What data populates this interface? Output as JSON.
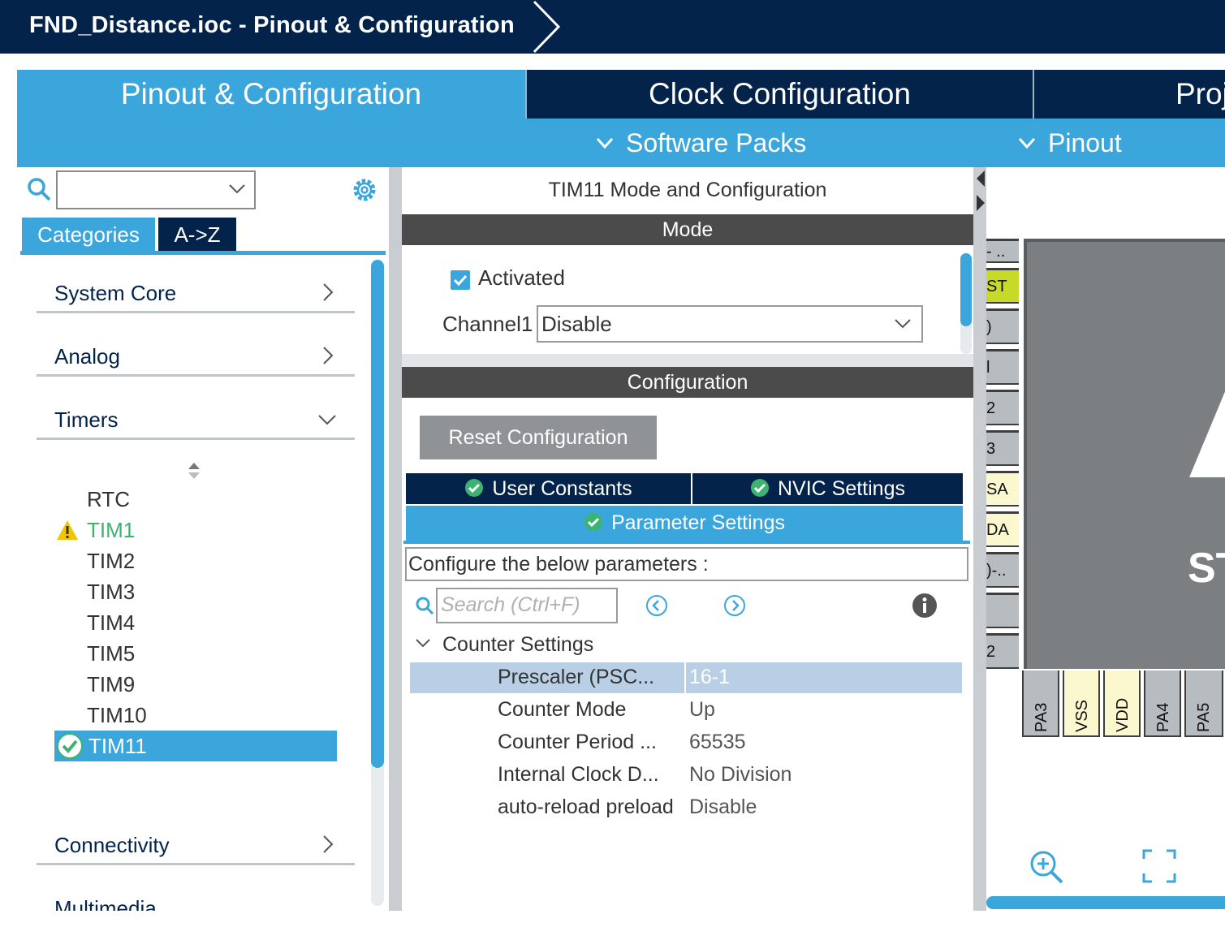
{
  "window": {
    "title": "FND_Distance.ioc - Pinout & Configuration"
  },
  "main_tabs": [
    {
      "label": "Pinout & Configuration",
      "active": true
    },
    {
      "label": "Clock Configuration",
      "active": false
    },
    {
      "label": "Proj",
      "active": false
    }
  ],
  "subbar": {
    "software_packs": "Software Packs",
    "pinout": "Pinout"
  },
  "left": {
    "search_value": "",
    "tabs": {
      "categories": "Categories",
      "az": "A->Z"
    },
    "categories": [
      {
        "label": "System Core",
        "expanded": false
      },
      {
        "label": "Analog",
        "expanded": false
      },
      {
        "label": "Timers",
        "expanded": true
      },
      {
        "label": "Connectivity",
        "expanded": false
      },
      {
        "label": "Multimedia",
        "expanded": false
      }
    ],
    "timers": [
      "RTC",
      "TIM1",
      "TIM2",
      "TIM3",
      "TIM4",
      "TIM5",
      "TIM9",
      "TIM10",
      "TIM11"
    ],
    "timer_warning": "TIM1",
    "timer_selected": "TIM11"
  },
  "mid": {
    "title": "TIM11 Mode and Configuration",
    "mode_header": "Mode",
    "activated_label": "Activated",
    "activated": true,
    "channel1_label": "Channel1",
    "channel1_value": "Disable",
    "config_header": "Configuration",
    "reset_button": "Reset Configuration",
    "tabs": {
      "user_constants": "User Constants",
      "nvic_settings": "NVIC Settings",
      "parameter_settings": "Parameter Settings"
    },
    "configure_text": "Configure the below parameters :",
    "param_search_placeholder": "Search (Ctrl+F)",
    "group": "Counter Settings",
    "params": [
      {
        "name": "Prescaler (PSC...",
        "value": "16-1",
        "selected": true
      },
      {
        "name": "Counter Mode",
        "value": "Up"
      },
      {
        "name": "Counter Period ...",
        "value": "65535"
      },
      {
        "name": "Internal Clock D...",
        "value": "No Division"
      },
      {
        "name": "auto-reload preload",
        "value": "Disable"
      }
    ]
  },
  "chip": {
    "text": "ST",
    "left_pins": [
      "- ..",
      "ST",
      ")",
      "l",
      "2",
      "3",
      "SA",
      "DA",
      ")-..",
      "",
      "2"
    ],
    "bottom_pins": [
      "PA3",
      "VSS",
      "VDD",
      "PA4",
      "PA5"
    ]
  },
  "colors": {
    "navy": "#03234b",
    "blue": "#3ba6dc",
    "gray": "#4b4b4b",
    "warn": "#f5c400",
    "ok": "#3cb371"
  }
}
